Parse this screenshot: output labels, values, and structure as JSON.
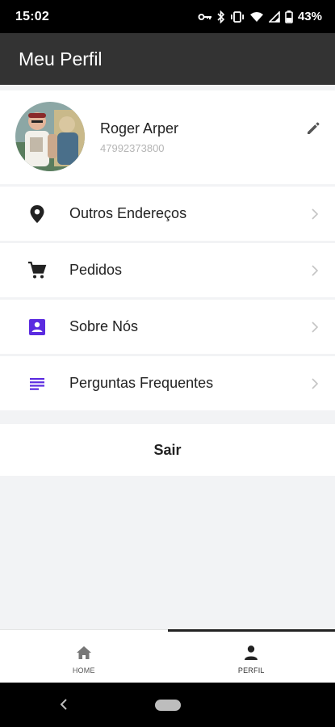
{
  "status_bar": {
    "time": "15:02",
    "battery": "43%",
    "icons": [
      "vpn-key-icon",
      "bluetooth-icon",
      "vibrate-icon",
      "wifi-icon",
      "signal-icon",
      "battery-icon"
    ]
  },
  "app_bar": {
    "title": "Meu Perfil"
  },
  "profile": {
    "name": "Roger Arper",
    "phone": "47992373800",
    "edit_icon": "pencil-icon"
  },
  "menu": {
    "items": [
      {
        "label": "Outros Endereços",
        "icon": "location-pin-icon",
        "icon_color": "#222222"
      },
      {
        "label": "Pedidos",
        "icon": "shopping-cart-icon",
        "icon_color": "#222222"
      },
      {
        "label": "Sobre Nós",
        "icon": "contact-card-icon",
        "icon_color": "#5b2be0"
      },
      {
        "label": "Perguntas Frequentes",
        "icon": "notes-list-icon",
        "icon_color": "#5b2be0"
      }
    ]
  },
  "logout": {
    "label": "Sair"
  },
  "bottom_nav": {
    "items": [
      {
        "label": "HOME",
        "icon": "home-icon",
        "active": false
      },
      {
        "label": "PERFIL",
        "icon": "person-icon",
        "active": true
      }
    ]
  },
  "colors": {
    "app_bar": "#333333",
    "accent": "#5b2be0",
    "background": "#f2f3f5"
  }
}
